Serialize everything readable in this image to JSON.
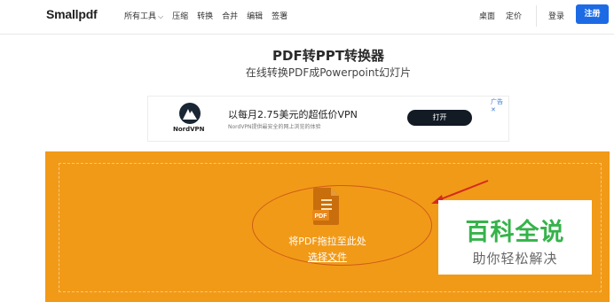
{
  "header": {
    "logo": "Smallpdf",
    "nav_left": [
      {
        "label": "所有工具",
        "dropdown": true
      },
      {
        "label": "压缩"
      },
      {
        "label": "转换"
      },
      {
        "label": "合并"
      },
      {
        "label": "编辑"
      },
      {
        "label": "签署"
      }
    ],
    "nav_right": [
      "桌面",
      "定价"
    ],
    "login": "登录",
    "signup": "注册"
  },
  "hero": {
    "title": "PDF转PPT转换器",
    "subtitle": "在线转换PDF成Powerpoint幻灯片"
  },
  "ad": {
    "brand": "NordVPN",
    "headline": "以每月2.75美元的超低价VPN",
    "sub": "NordVPN提供最安全的网上浏览的体验",
    "cta": "打开",
    "choice": "广告 ✕"
  },
  "dropzone": {
    "icon_label": "PDF",
    "text": "将PDF拖拉至此处",
    "select": "选择文件"
  },
  "watermark": {
    "title": "百科全说",
    "sub": "助你轻松解决"
  },
  "colors": {
    "accent": "#1d6ae5",
    "dropzone": "#f19a18",
    "watermark": "#35b34a"
  }
}
